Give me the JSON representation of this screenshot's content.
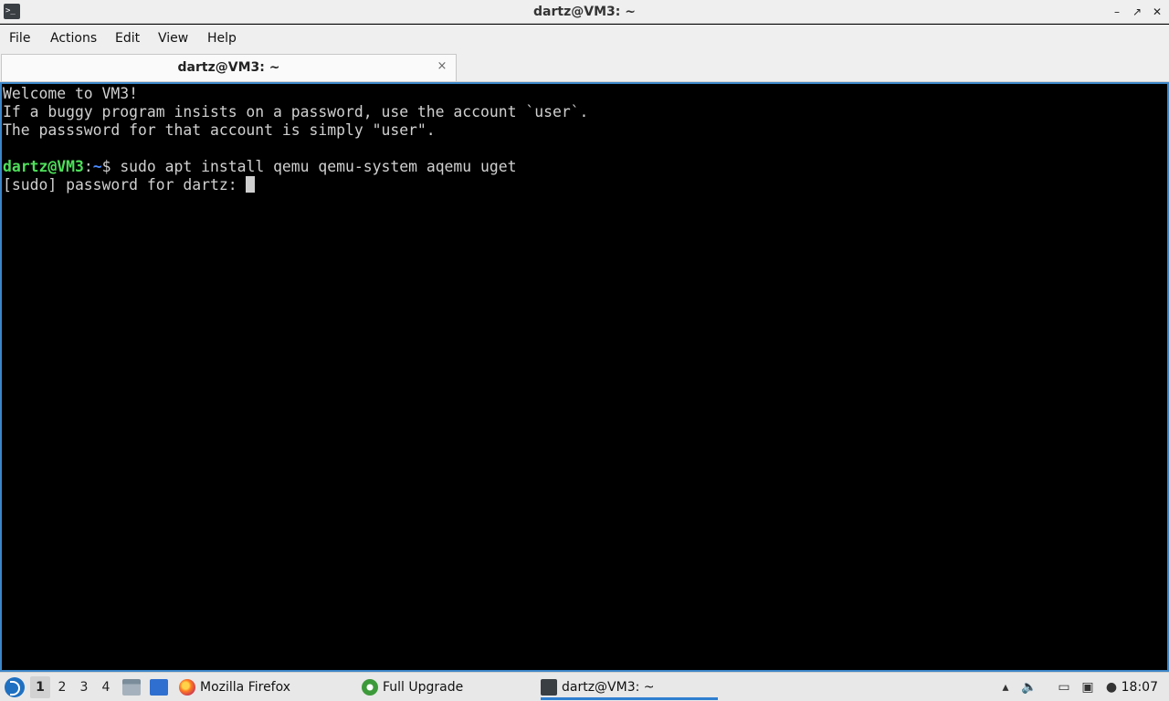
{
  "window": {
    "title": "dartz@VM3: ~",
    "minimize_glyph": "–",
    "maximize_glyph": "↗",
    "close_glyph": "✕",
    "app_icon_text": ">_"
  },
  "menu": {
    "file": "File",
    "actions": "Actions",
    "edit": "Edit",
    "view": "View",
    "help": "Help"
  },
  "tabs": [
    {
      "label": "dartz@VM3: ~",
      "close_glyph": "×",
      "active": true
    }
  ],
  "terminal": {
    "lines": [
      "Welcome to VM3!",
      "If a buggy program insists on a password, use the account `user`.",
      "The passsword for that account is simply \"user\"."
    ],
    "prompt_user": "dartz@VM3",
    "prompt_sep": ":",
    "prompt_path": "~",
    "prompt_symbol": "$ ",
    "command": "sudo apt install qemu qemu-system aqemu uget",
    "sudo_prompt": "[sudo] password for dartz: "
  },
  "taskbar": {
    "desktops": [
      "1",
      "2",
      "3",
      "4"
    ],
    "active_desktop": "1",
    "tasks": [
      {
        "label": "Mozilla Firefox",
        "icon": "firefox-icon"
      },
      {
        "label": "Full Upgrade",
        "icon": "upgrade-icon"
      },
      {
        "label": "dartz@VM3: ~",
        "icon": "terminal-icon",
        "active": true
      }
    ],
    "clock": "18:07"
  },
  "colors": {
    "prompt_user": "#4ee05a",
    "prompt_path": "#4a8bff",
    "terminal_border": "#3c86c8",
    "terminal_bg": "#000000"
  }
}
